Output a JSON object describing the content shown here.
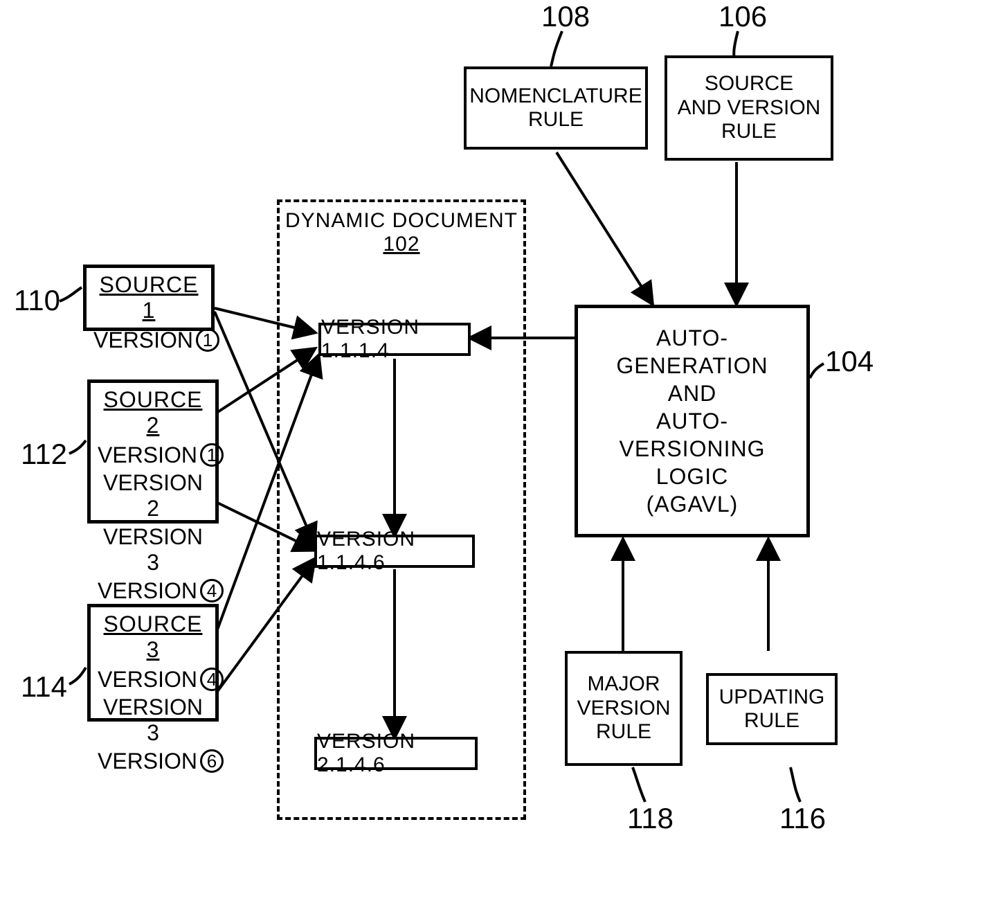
{
  "refs": {
    "r102": "102",
    "r104": "104",
    "r106": "106",
    "r108": "108",
    "r110": "110",
    "r112": "112",
    "r114": "114",
    "r116": "116",
    "r118": "118"
  },
  "dynamic_document": {
    "title": "DYNAMIC DOCUMENT",
    "versions": {
      "v1": "VERSION 1.1.1.4",
      "v2": "VERSION 1.1.4.6",
      "v3": "VERSION 2.1.4.6"
    }
  },
  "sources": {
    "s1": {
      "title": "SOURCE 1",
      "rows": [
        {
          "label": "VERSION",
          "circled": "1"
        }
      ]
    },
    "s2": {
      "title": "SOURCE 2",
      "rows": [
        {
          "label": "VERSION",
          "circled": "1"
        },
        {
          "label": "VERSION 2"
        },
        {
          "label": "VERSION 3"
        },
        {
          "label": "VERSION",
          "circled": "4"
        }
      ]
    },
    "s3": {
      "title": "SOURCE 3",
      "rows": [
        {
          "label": "VERSION",
          "circled": "4"
        },
        {
          "label": "VERSION 3"
        },
        {
          "label": "VERSION",
          "circled": "6"
        }
      ]
    }
  },
  "rules": {
    "nomenclature": "NOMENCLATURE\nRULE",
    "source_version": "SOURCE\nAND VERSION\nRULE",
    "major_version": "MAJOR\nVERSION\nRULE",
    "updating": "UPDATING\nRULE"
  },
  "agavl": "AUTO-GENERATION\nAND\nAUTO-VERSIONING\nLOGIC\n(AGAVL)"
}
